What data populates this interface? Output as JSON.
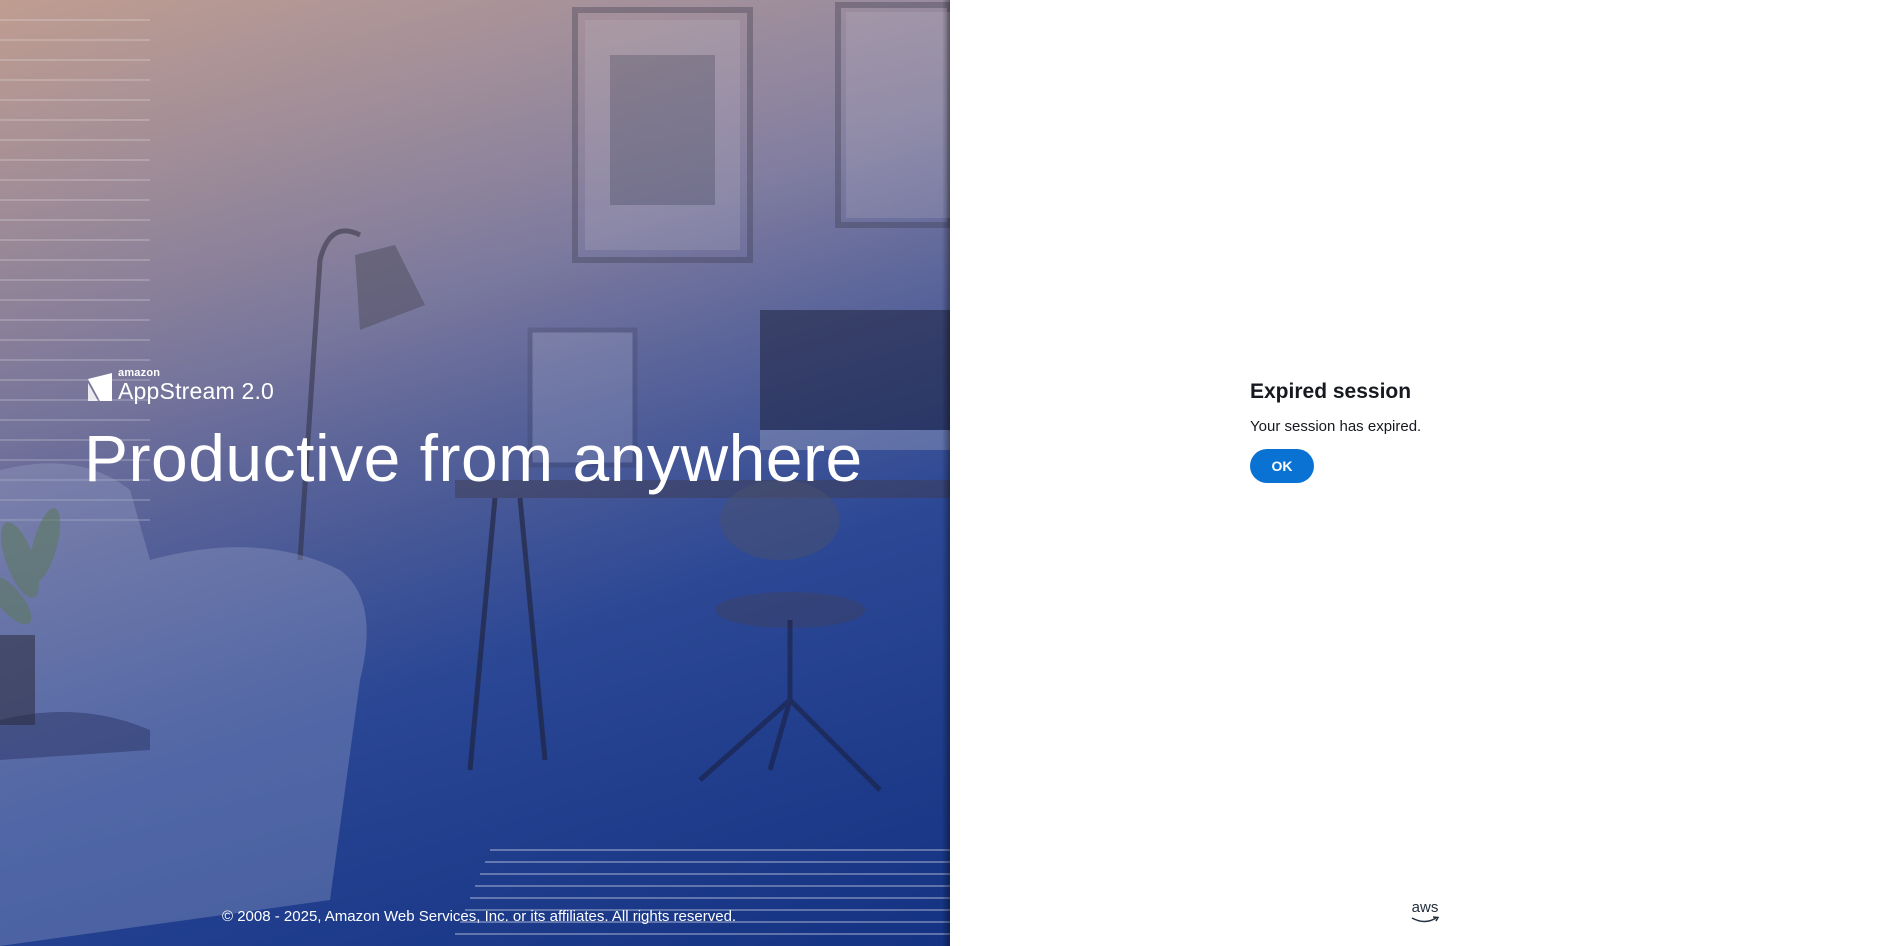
{
  "hero": {
    "logo": {
      "brand": "amazon",
      "product": "AppStream 2.0"
    },
    "headline": "Productive from anywhere",
    "copyright": "© 2008 - 2025, Amazon Web Services, Inc. or its affiliates. All rights reserved."
  },
  "dialog": {
    "title": "Expired session",
    "message": "Your session has expired.",
    "ok_label": "OK"
  },
  "footer": {
    "aws_logo_text": "aws"
  },
  "colors": {
    "primary_button": "#0972d3",
    "hero_overlay": "#1f3b85",
    "text": "#16191f"
  }
}
